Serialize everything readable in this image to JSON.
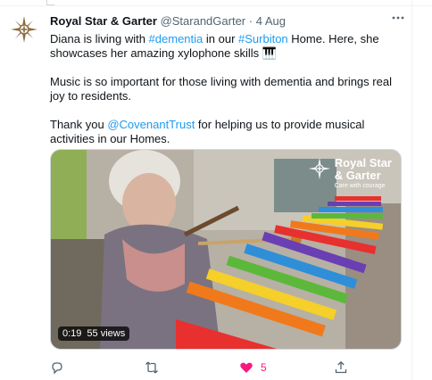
{
  "tweet": {
    "author_name": "Royal Star & Garter",
    "author_handle": "@StarandGarter",
    "separator": "·",
    "time": "4 Aug",
    "paragraphs": [
      {
        "before": "Diana is living with ",
        "tag1": "#dementia",
        "middle": " in our ",
        "tag2": "#Surbiton",
        "after": " Home. Here, she showcases her amazing xylophone skills 🎹"
      },
      {
        "text": "Music is so important for those living with dementia and brings real joy to residents."
      },
      {
        "before": "Thank you ",
        "mention": "@CovenantTrust",
        "after": " for helping us to provide musical activities in our Homes."
      }
    ]
  },
  "video": {
    "duration": "0:19",
    "views": "55 views",
    "logo_line1": "Royal Star",
    "logo_line2": "& Garter",
    "logo_tagline": "Care with courage"
  },
  "actions": {
    "reply_count": "",
    "retweet_count": "",
    "like_count": "5",
    "share_count": ""
  },
  "icons": [
    "more-icon",
    "reply-icon",
    "retweet-icon",
    "heart-icon",
    "share-icon",
    "star-logo-icon"
  ],
  "colors": {
    "link": "#1d9bf0",
    "like": "#f91880",
    "secondary_text": "#536471",
    "logo_brown": "#8b6a3b"
  }
}
